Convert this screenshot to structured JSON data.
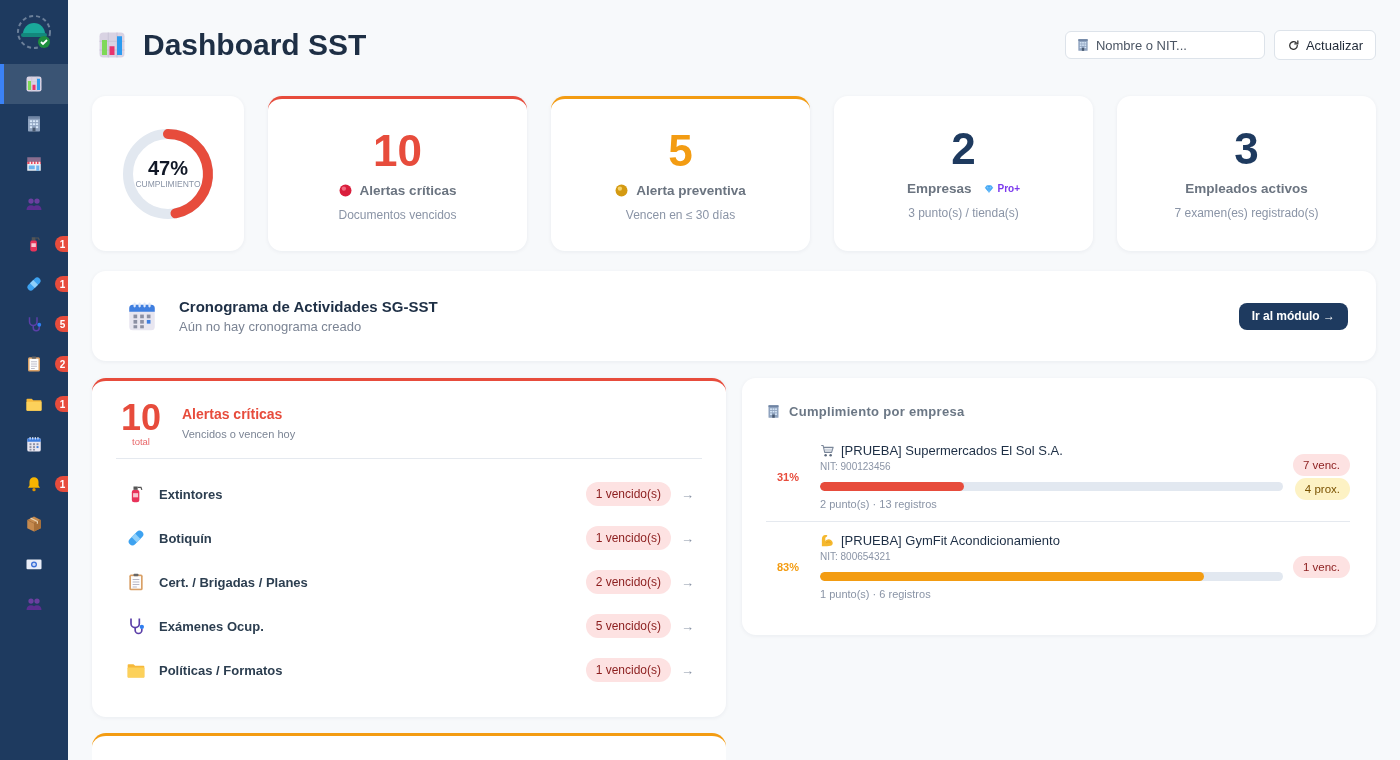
{
  "sidebar": {
    "items": [
      {
        "selected": true
      },
      {
        "selected": false
      },
      {
        "selected": false
      },
      {
        "selected": false
      },
      {
        "selected": false,
        "badge": "1"
      },
      {
        "selected": false,
        "badge": "1"
      },
      {
        "selected": false,
        "badge": "5"
      },
      {
        "selected": false,
        "badge": "2"
      },
      {
        "selected": false,
        "badge": "1"
      },
      {
        "selected": false
      },
      {
        "selected": false,
        "badge": "1"
      },
      {
        "selected": false
      },
      {
        "selected": false
      },
      {
        "selected": false
      }
    ]
  },
  "header": {
    "title": "Dashboard SST",
    "search": {
      "placeholder": "Nombre o NIT..."
    },
    "refresh_button": "Actualizar"
  },
  "compliance": {
    "value": "47%",
    "label": "CUMPLIMIENTO",
    "level": 0.47
  },
  "stats": [
    {
      "kind": "critical",
      "value": "10",
      "label": "Alertas críticas",
      "caption": "Documentos vencidos"
    },
    {
      "kind": "preventive",
      "value": "5",
      "label": "Alerta preventiva",
      "caption": "Vencen en ≤ 30 días"
    },
    {
      "kind": "count",
      "value": "2",
      "label": "Empresas",
      "plan": "Pro+",
      "caption": "3 punto(s) / tienda(s)"
    },
    {
      "kind": "count",
      "value": "3",
      "label": "Empleados activos",
      "caption": "7 examen(es) registrado(s)"
    }
  ],
  "schedule": {
    "title": "Cronograma de Actividades SG-SST",
    "subtitle": "Aún no hay cronograma creado",
    "button": "Ir al módulo →"
  },
  "critical_alerts": {
    "total": "10",
    "total_label": "total",
    "title": "Alertas críticas",
    "subtitle": "Vencidos o vencen hoy",
    "items": [
      {
        "label": "Extintores",
        "count": "1 vencido(s)",
        "arrow": "→"
      },
      {
        "label": "Botiquín",
        "count": "1 vencido(s)",
        "arrow": "→"
      },
      {
        "label": "Cert. / Brigadas / Planes",
        "count": "2 vencido(s)",
        "arrow": "→"
      },
      {
        "label": "Exámenes Ocup.",
        "count": "5 vencido(s)",
        "arrow": "→"
      },
      {
        "label": "Políticas / Formatos",
        "count": "1 vencido(s)",
        "arrow": "→"
      }
    ]
  },
  "company_compliance": {
    "title": "Cumplimiento por empresa",
    "companies": [
      {
        "percent": "31%",
        "color": "#e74c3c",
        "name": "[PRUEBA] Supermercados El Sol S.A.",
        "nit": "NIT: 900123456",
        "level": 0.31,
        "details": "2 punto(s) · 13 registros",
        "tags": [
          {
            "kind": "overdue",
            "text": "7 venc."
          },
          {
            "kind": "upcoming",
            "text": "4 prox."
          }
        ]
      },
      {
        "percent": "83%",
        "color": "#f39c12",
        "name": "[PRUEBA] GymFit Acondicionamiento",
        "nit": "NIT: 800654321",
        "level": 0.83,
        "details": "1 punto(s) · 6 registros",
        "tags": [
          {
            "kind": "overdue",
            "text": "1 venc."
          }
        ]
      }
    ]
  }
}
